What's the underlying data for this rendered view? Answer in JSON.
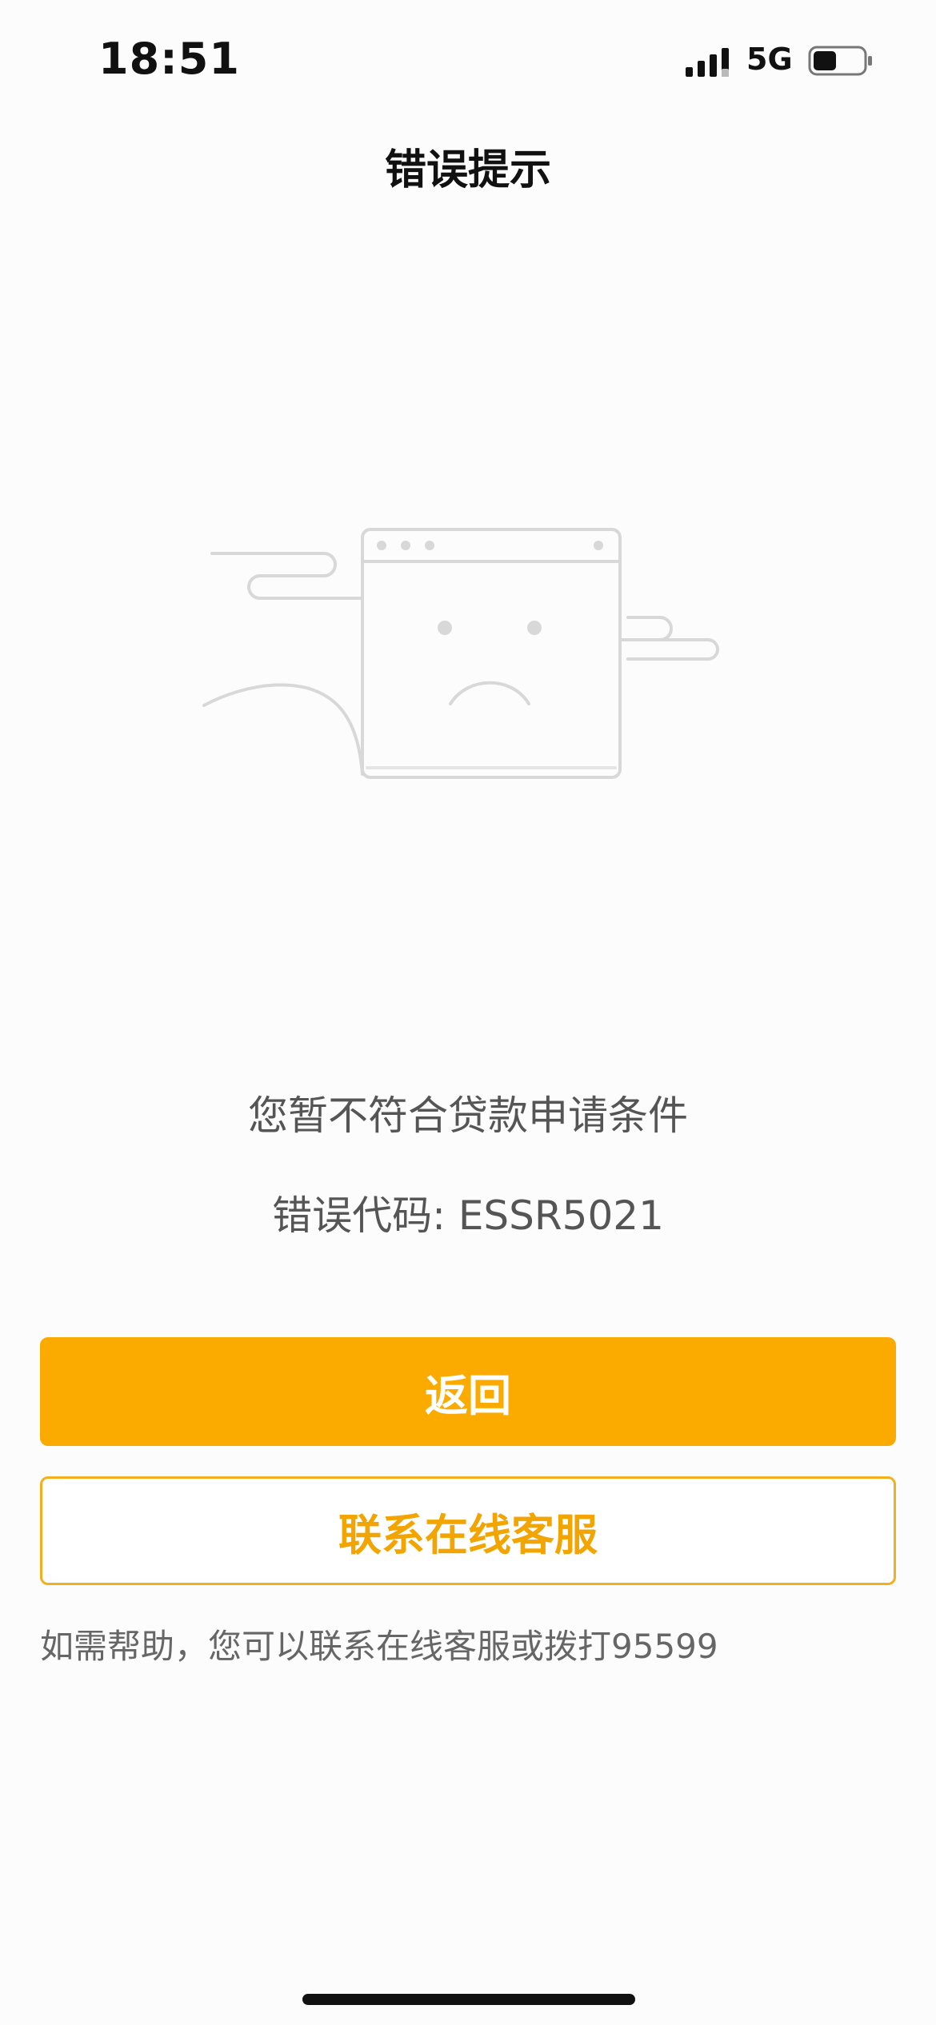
{
  "status_bar": {
    "time": "18:51",
    "network": "5G",
    "signal_icon": "signal-bars-icon",
    "battery_icon": "battery-icon"
  },
  "nav": {
    "title": "错误提示"
  },
  "illustration": {
    "icon": "sad-browser-window-icon"
  },
  "content": {
    "message": "您暂不符合贷款申请条件",
    "error_code": "错误代码: ESSR5021"
  },
  "buttons": {
    "back_label": "返回",
    "contact_label": "联系在线客服"
  },
  "help": {
    "text": "如需帮助，您可以联系在线客服或拨打95599"
  },
  "colors": {
    "accent": "#fbab00",
    "accent_text": "#f2a400",
    "background": "#fcfcfc",
    "secondary_text": "#555555"
  }
}
